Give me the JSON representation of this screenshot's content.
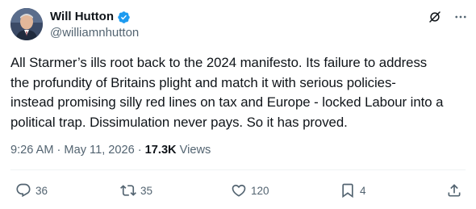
{
  "author": {
    "display_name": "Will Hutton",
    "handle": "@williamnhutton",
    "verified": true
  },
  "top_icons": [
    "grok-icon",
    "more-options-icon"
  ],
  "post": {
    "text": "All Starmer’s ills root back to the 2024 manifesto. Its failure to address\nthe profundity of Britains plight and match it with serious policies-\ninstead promising silly red lines on tax and Europe - locked Labour into a\npolitical trap. Dissimulation never pays. So it has proved."
  },
  "meta": {
    "time": "9:26 AM",
    "separator": "·",
    "date": "May 11, 2026",
    "views_count": "17.3K",
    "views_label": "Views"
  },
  "actions": {
    "replies": "36",
    "reposts": "35",
    "likes": "120",
    "bookmarks": "4"
  },
  "colors": {
    "text": "#0f1419",
    "secondary": "#536471",
    "verified": "#1d9bf0",
    "divider": "#eff3f4"
  }
}
